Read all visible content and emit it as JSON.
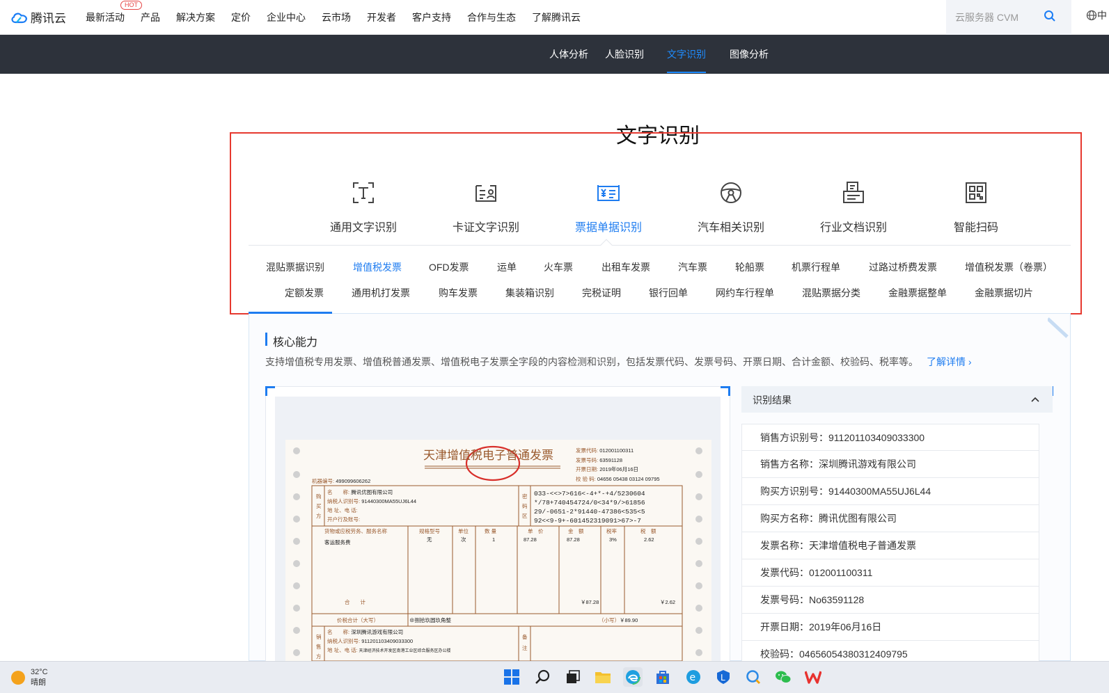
{
  "header": {
    "logo_text": "腾讯云",
    "nav": [
      "最新活动",
      "产品",
      "解决方案",
      "定价",
      "企业中心",
      "云市场",
      "开发者",
      "客户支持",
      "合作与生态",
      "了解腾讯云"
    ],
    "hot_badge": "HOT",
    "search_placeholder": "云服务器 CVM",
    "lang_fragment": "中"
  },
  "subnav": {
    "items": [
      "人体分析",
      "人脸识别",
      "文字识别",
      "图像分析"
    ],
    "active": "文字识别"
  },
  "page_title": "文字识别",
  "categories": [
    {
      "label": "通用文字识别",
      "icon": "text-scan-icon"
    },
    {
      "label": "卡证文字识别",
      "icon": "id-card-icon"
    },
    {
      "label": "票据单据识别",
      "icon": "invoice-icon"
    },
    {
      "label": "汽车相关识别",
      "icon": "steering-wheel-icon"
    },
    {
      "label": "行业文档识别",
      "icon": "document-icon"
    },
    {
      "label": "智能扫码",
      "icon": "qr-code-icon"
    }
  ],
  "active_category": "票据单据识别",
  "subcategories_row1": [
    "混贴票据识别",
    "增值税发票",
    "OFD发票",
    "运单",
    "火车票",
    "出租车发票",
    "汽车票",
    "轮船票",
    "机票行程单",
    "过路过桥费发票",
    "增值税发票（卷票）"
  ],
  "subcategories_row2": [
    "定额发票",
    "通用机打发票",
    "购车发票",
    "集装箱识别",
    "完税证明",
    "银行回单",
    "网约车行程单",
    "混贴票据分类",
    "金融票据整单",
    "金融票据切片"
  ],
  "active_subcategory": "增值税发票",
  "core": {
    "title": "核心能力",
    "description": "支持增值税专用发票、增值税普通发票、增值税电子发票全字段的内容检测和识别，包括发票代码、发票号码、开票日期、合计金额、校验码、税率等。",
    "more_link": "了解详情"
  },
  "invoice": {
    "title": "天津增值税电子普通发票",
    "code_label": "发票代码:",
    "code": "012001100311",
    "number_label": "发票号码:",
    "number": "63591128",
    "date_label": "开票日期:",
    "date": "2019年06月16日",
    "check_label": "校 验 码:",
    "check": "04656 05438 03124 09795",
    "machine_label": "机器编号:",
    "machine": "499099606262",
    "buyer_side": [
      "购",
      "买",
      "方"
    ],
    "buyer_name_label": "名　　称:",
    "buyer_name": "腾讯优图有限公司",
    "buyer_tax_label": "纳税人识别号:",
    "buyer_tax": "91440300MA55UJ6L44",
    "addr_label": "地 址、电 话:",
    "bank_label": "开户行及账号:",
    "cipher_side": [
      "密",
      "码",
      "区"
    ],
    "cipher": [
      "033-<<>7>616<-4+*-+4/5230604",
      "*/78+740454724/0<34*9/>61856",
      "29/-0651-2*91440-47386<535<5",
      "92<<9-9+-601452319091>67>-7"
    ],
    "col_item": "货物或应税劳务、服务名称",
    "col_spec": "规格型号",
    "col_unit": "单位",
    "col_qty": "数 量",
    "col_price": "单　价",
    "col_amount": "金　额",
    "col_rate": "税率",
    "col_tax": "税　额",
    "item": "客运服务费",
    "spec": "无",
    "unit": "次",
    "qty": "1",
    "price": "87.28",
    "amount": "87.28",
    "rate": "3%",
    "tax": "2.62",
    "total_label": "合　　计",
    "total_amount": "￥87.28",
    "total_tax": "￥2.62",
    "grand_label": "价税合计（大写）",
    "grand_upper": "⊗捌拾玖圆玖角整",
    "grand_small_label": "（小写）",
    "grand_small": "￥89.90",
    "seller_side": [
      "销",
      "售",
      "方"
    ],
    "seller_name_label": "名　　称:",
    "seller_name": "深圳腾讯游戏有限公司",
    "seller_tax_label": "纳税人识别号:",
    "seller_tax": "911201103409033300",
    "seller_addr_label": "地 址、电 话:",
    "seller_addr": "天津经济技术开发区南港工业区综合服务区办公楼",
    "remark_side": [
      "备",
      "注"
    ]
  },
  "result": {
    "title": "识别结果",
    "rows": [
      "销售方识别号：911201103409033300",
      "销售方名称：深圳腾讯游戏有限公司",
      "购买方识别号：91440300MA55UJ6L44",
      "购买方名称：腾讯优图有限公司",
      "发票名称：天津增值税电子普通发票",
      "发票代码：012001100311",
      "发票号码：No63591128",
      "开票日期：2019年06月16日",
      "校验码：04656054380312409795"
    ]
  },
  "taskbar": {
    "temp": "32°C",
    "weather": "晴朗"
  },
  "colors": {
    "accent": "#1e7cf0",
    "highlight_box": "#e6392f",
    "subnav_bg": "#2d323b",
    "invoice_ink": "#9a5a2e"
  }
}
